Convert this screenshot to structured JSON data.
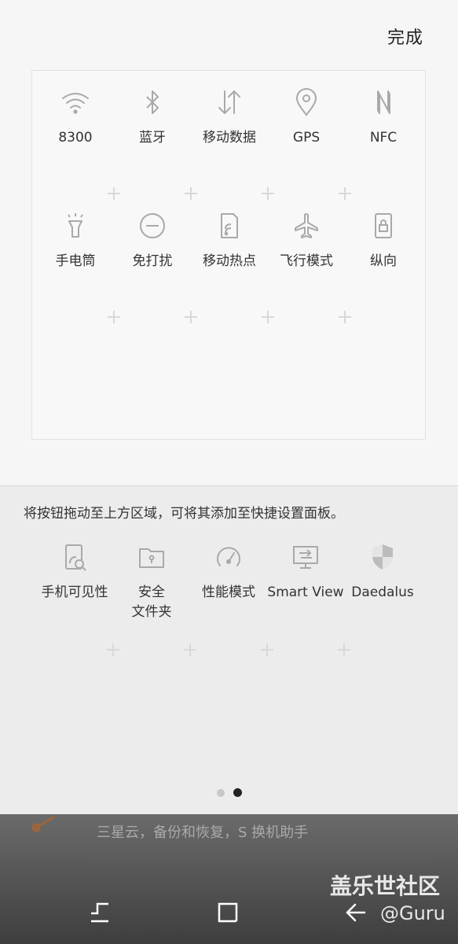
{
  "header": {
    "done_label": "完成"
  },
  "active_tiles": [
    {
      "label": "8300",
      "icon": "wifi-icon"
    },
    {
      "label": "蓝牙",
      "icon": "bluetooth-icon"
    },
    {
      "label": "移动数据",
      "icon": "mobile-data-icon"
    },
    {
      "label": "GPS",
      "icon": "location-pin-icon"
    },
    {
      "label": "NFC",
      "icon": "nfc-icon"
    },
    {
      "label": "手电筒",
      "icon": "flashlight-icon"
    },
    {
      "label": "免打扰",
      "icon": "do-not-disturb-icon"
    },
    {
      "label": "移动热点",
      "icon": "hotspot-icon"
    },
    {
      "label": "飞行模式",
      "icon": "airplane-icon"
    },
    {
      "label": "纵向",
      "icon": "portrait-lock-icon"
    }
  ],
  "tray": {
    "hint": "将按钮拖动至上方区域，可将其添加至快捷设置面板。",
    "tiles": [
      {
        "label": "手机可见性",
        "icon": "phone-visibility-icon"
      },
      {
        "label": "安全\n文件夹",
        "line1": "安全",
        "line2": "文件夹",
        "icon": "secure-folder-icon"
      },
      {
        "label": "性能模式",
        "icon": "performance-gauge-icon"
      },
      {
        "label": "Smart View",
        "icon": "smart-view-icon"
      },
      {
        "label": "Daedalus",
        "icon": "shield-icon"
      }
    ],
    "page_count": 2,
    "current_page": 2
  },
  "background": {
    "subtitle": "三星云，备份和恢复，S 换机助手",
    "watermark": "盖乐世社区",
    "watermark_handle": "@Guru"
  },
  "colors": {
    "icon": "#a9a9a9",
    "text": "#333333",
    "tray_bg": "#ececec"
  }
}
